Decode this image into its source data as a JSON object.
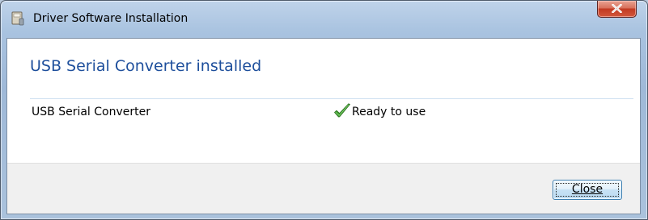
{
  "window": {
    "title": "Driver Software Installation",
    "close_glyph": "x",
    "icon": "setup-icon"
  },
  "main": {
    "heading": "USB Serial Converter installed",
    "devices": [
      {
        "name": "USB Serial Converter",
        "status": "Ready to use",
        "status_icon": "check-icon"
      }
    ]
  },
  "footer": {
    "close_label": "Close"
  },
  "colors": {
    "heading": "#1e4f9c",
    "check": "#3c9a2d",
    "caption_close": "#c13a22"
  }
}
